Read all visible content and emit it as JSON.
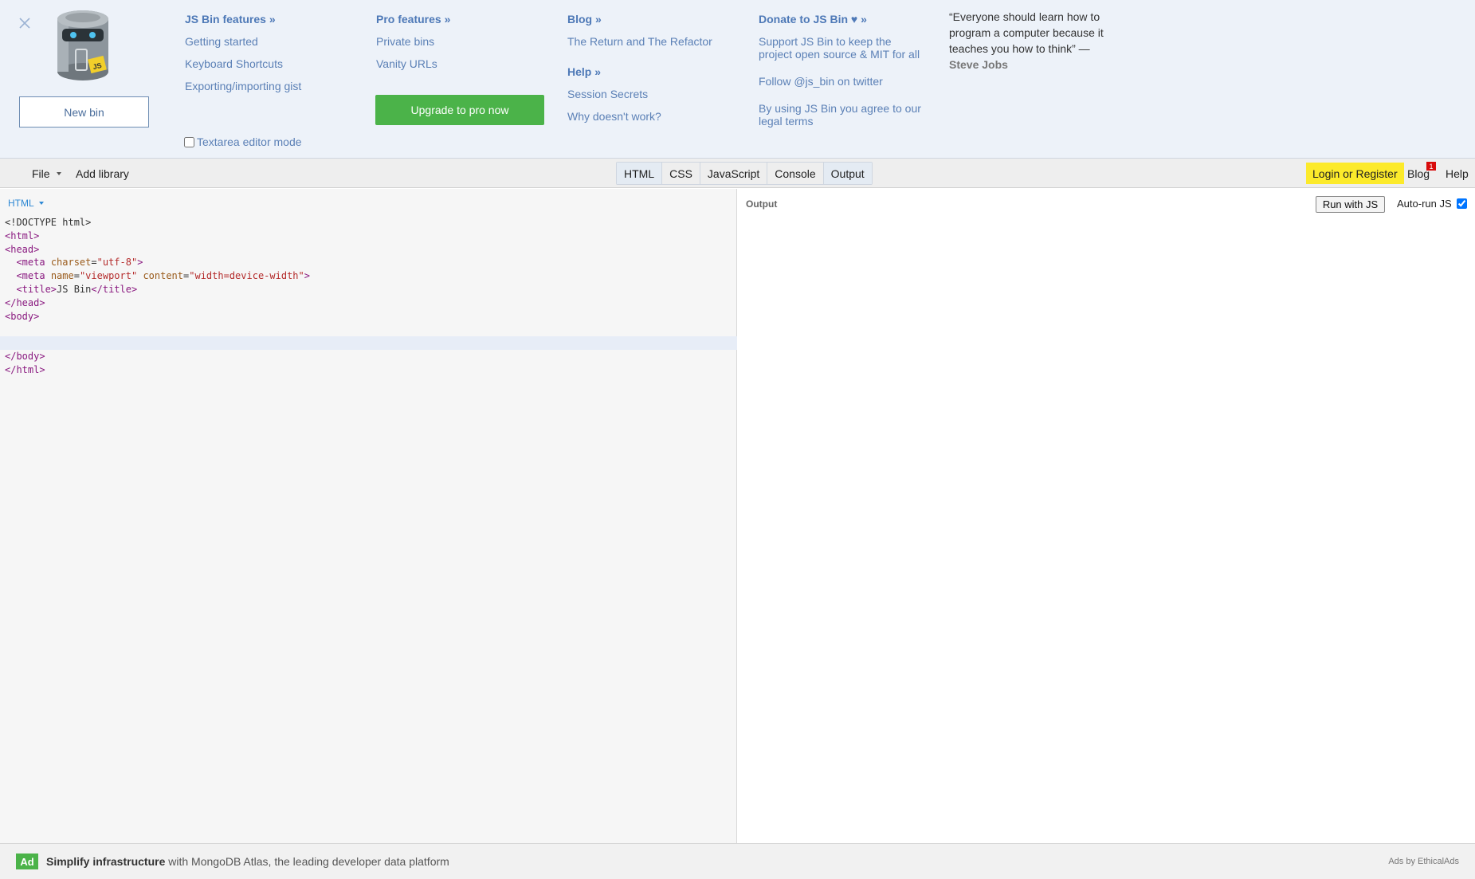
{
  "info_panel": {
    "new_bin_label": "New bin",
    "features": {
      "heading": "JS Bin features »",
      "links": [
        "Getting started",
        "Keyboard Shortcuts",
        "Exporting/importing gist"
      ]
    },
    "textarea_mode_label": "Textarea editor mode",
    "pro": {
      "heading": "Pro features »",
      "links": [
        "Private bins",
        "Vanity URLs"
      ],
      "upgrade_label": "Upgrade to pro now"
    },
    "blog": {
      "heading": "Blog »",
      "links": [
        "The Return and The Refactor"
      ]
    },
    "help": {
      "heading": "Help »",
      "links": [
        "Session Secrets",
        "Why doesn't work?"
      ]
    },
    "donate": {
      "heading": "Donate to JS Bin ♥ »",
      "links": [
        "Support JS Bin to keep the project open source & MIT for all",
        "Follow @js_bin on twitter",
        "By using JS Bin you agree to our legal terms"
      ]
    },
    "quote": {
      "text": "“Everyone should learn how to program a computer because it teaches you how to think” —",
      "author": "Steve Jobs"
    }
  },
  "toolbar": {
    "file_label": "File",
    "add_library_label": "Add library",
    "tabs": [
      "HTML",
      "CSS",
      "JavaScript",
      "Console",
      "Output"
    ],
    "login_label": "Login or Register",
    "blog_label": "Blog",
    "blog_badge": "1",
    "help_label": "Help"
  },
  "editor": {
    "mode_label": "HTML"
  },
  "output": {
    "label": "Output",
    "run_label": "Run with JS",
    "autorun_label": "Auto-run JS",
    "autorun_checked": true
  },
  "ad": {
    "badge": "Ad",
    "title": "Simplify infrastructure",
    "text": " with MongoDB Atlas, the leading developer data platform",
    "by": "Ads by EthicalAds"
  },
  "colors": {
    "panel_bg": "#edf2f9",
    "link": "#5b80b6",
    "upgrade_green": "#4bb349",
    "login_yellow": "#fcea2b",
    "badge_red": "#d80b0b"
  }
}
